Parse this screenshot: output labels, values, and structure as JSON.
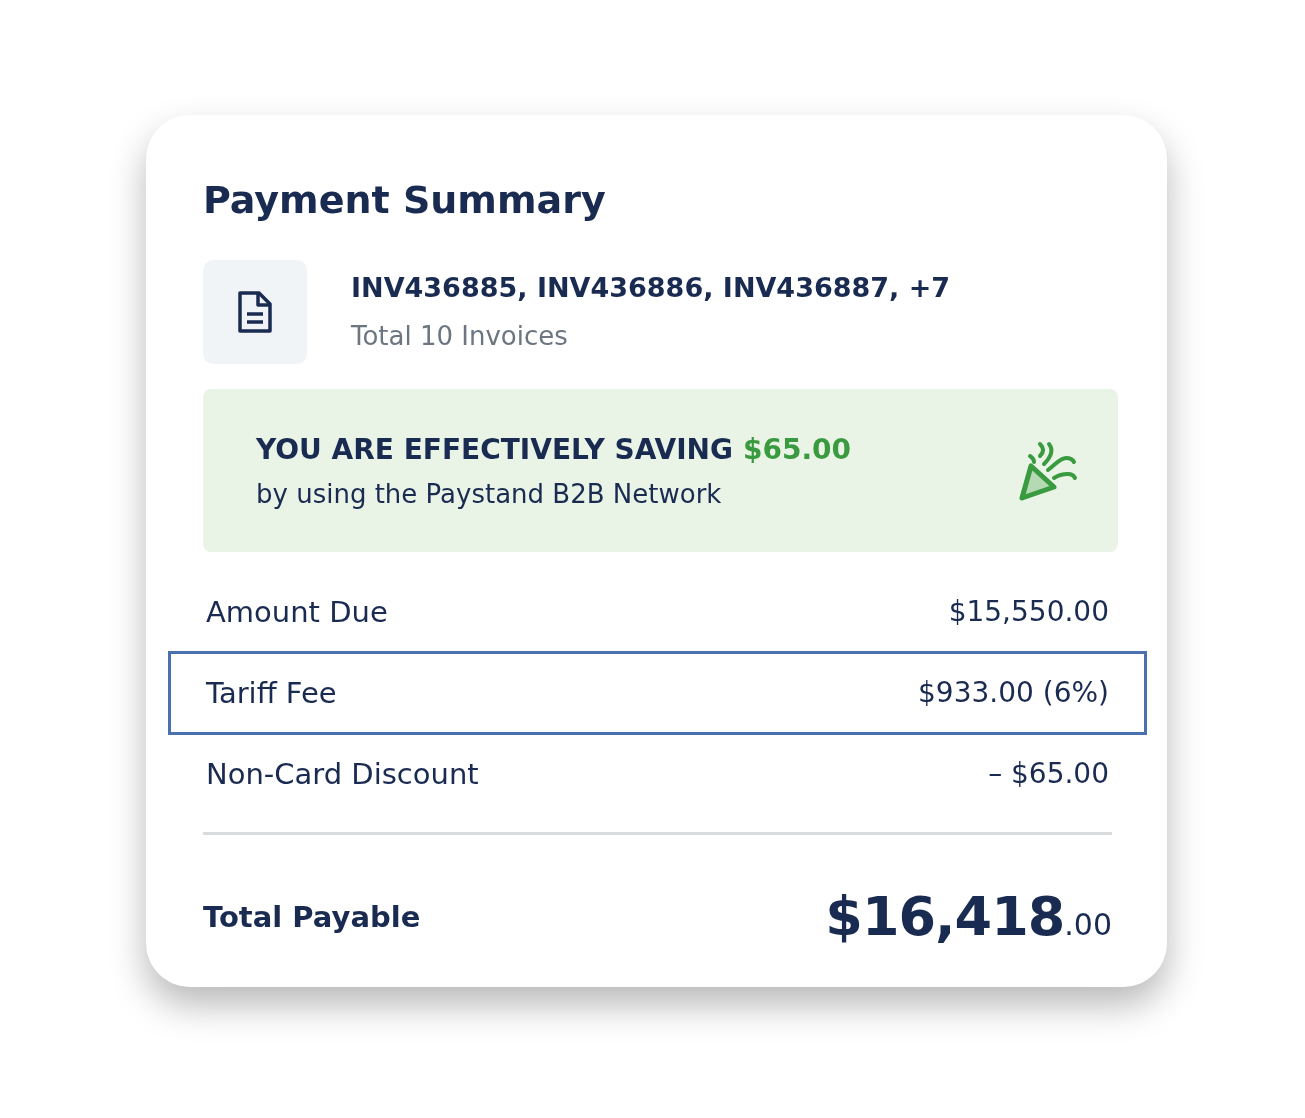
{
  "title": "Payment Summary",
  "invoices": {
    "numbers": "INV436885, INV436886, INV436887, +7",
    "count": "Total 10 Invoices"
  },
  "savings_banner": {
    "heading": "YOU ARE EFFECTIVELY SAVING",
    "amount": "$65.00",
    "subtext": "by using the Paystand B2B Network"
  },
  "line_items": [
    {
      "label": "Amount Due",
      "value": "$15,550.00",
      "highlighted": false
    },
    {
      "label": "Tariff Fee",
      "value": "$933.00 (6%)",
      "highlighted": true
    },
    {
      "label": "Non-Card Discount",
      "value": "– $65.00",
      "highlighted": false
    }
  ],
  "total": {
    "label": "Total Payable",
    "amount": "$16,418",
    "cents": ".00"
  }
}
